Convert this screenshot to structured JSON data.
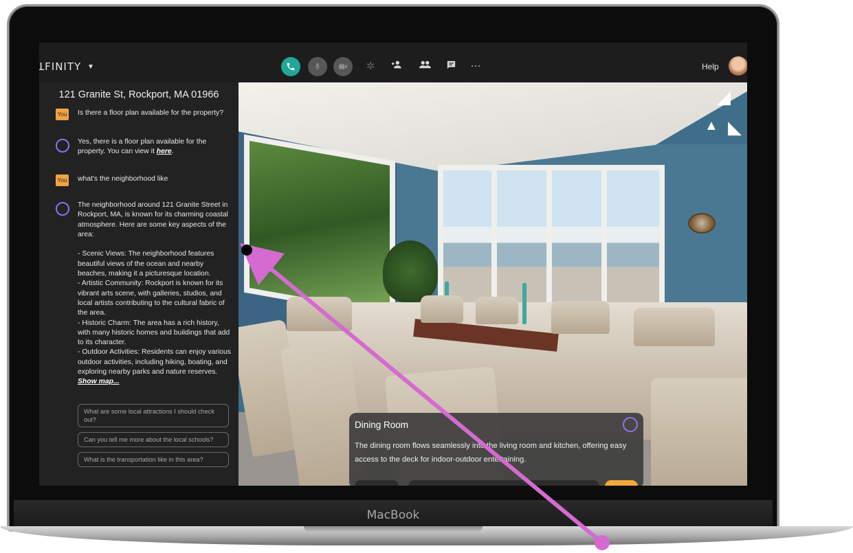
{
  "app": {
    "logo": "ꓕFINITY",
    "help_label": "Help"
  },
  "device": {
    "brand": "MacBook"
  },
  "toolbar": {
    "icons": [
      "phone-icon",
      "microphone-icon",
      "camera-icon",
      "settings-icon",
      "add-person-icon",
      "people-icon",
      "chat-icon",
      "more-icon"
    ],
    "more_label": "···"
  },
  "chat": {
    "address": "121 Granite St, Rockport, MA 01966",
    "you_label": "You",
    "messages": [
      {
        "from": "user",
        "text": "Is there a floor plan available for the property?"
      },
      {
        "from": "bot",
        "text_pre": "Yes, there is a floor plan available for the property. You can view it ",
        "link": "here",
        "text_post": "."
      },
      {
        "from": "user",
        "text": "what's the neighborhood like"
      },
      {
        "from": "bot",
        "text": "The neighborhood around 121 Granite Street in Rockport, MA, is known for its charming coastal atmosphere. Here are some key aspects of the area:\n\n- Scenic Views: The neighborhood features beautiful views of the ocean and nearby beaches, making it a picturesque location.\n- Artistic Community: Rockport is known for its vibrant arts scene, with galleries, studios, and local artists contributing to the cultural fabric of the area.\n- Historic Charm: The area has a rich history, with many historic homes and buildings that add to its character.\n- Outdoor Activities: Residents can enjoy various outdoor activities, including hiking, boating, and exploring nearby parks and nature reserves.",
        "link": "Show map..."
      }
    ],
    "suggestions": [
      "What are some local attractions I should check out?",
      "Can you tell me more about the local schools?",
      "What is the transportation like in this area?"
    ]
  },
  "room_card": {
    "title": "Dining Room",
    "description": "The dining room flows seamlessly into the living room and kitchen, offering easy access to the deck for indoor-outdoor entertaining."
  },
  "colors": {
    "accent_call": "#22a69a",
    "you_badge": "#f2a343",
    "bot_ring": "#8a74f0",
    "annotation": "#d56ad0"
  }
}
